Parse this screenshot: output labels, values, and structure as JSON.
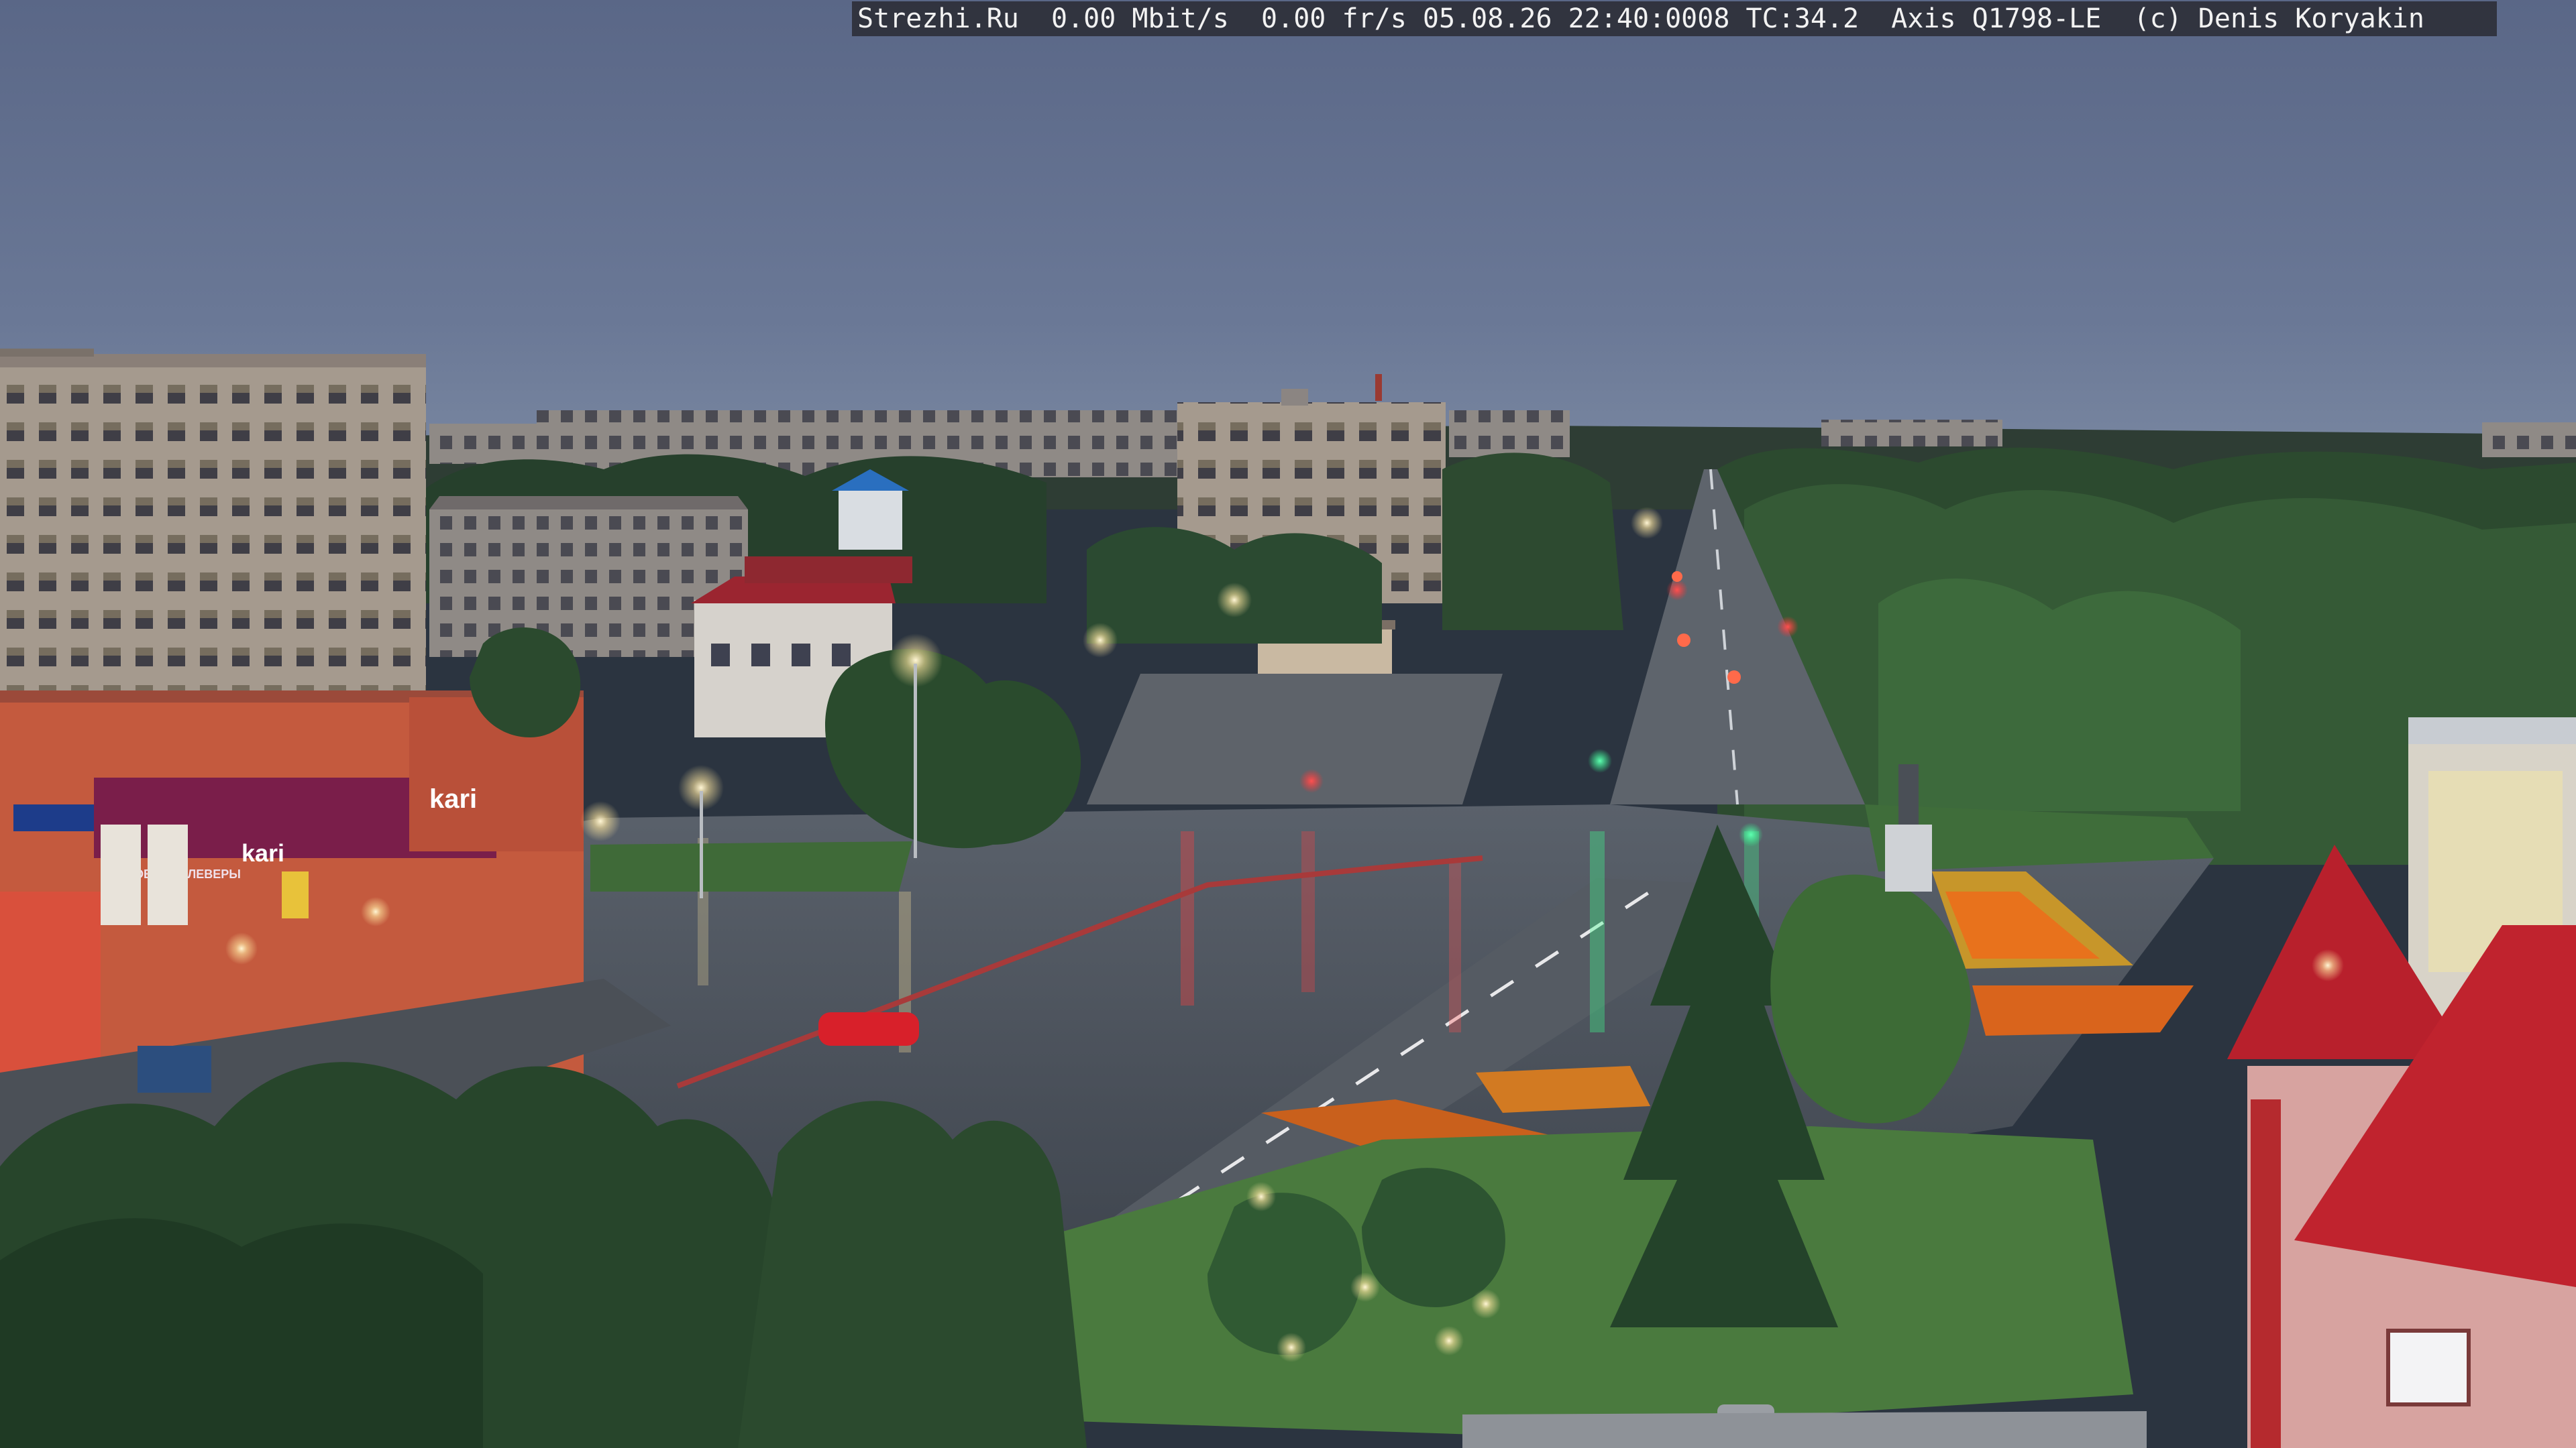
{
  "camera_overlay": {
    "text": "Strezhi.Ru  0.00 Mbit/s  0.00 fr/s 05.08.26 22:40:0008 TC:34.2  Axis Q1798-LE  (c) Denis Koryakin",
    "background": "#2a2a32",
    "color": "#f2f2f2"
  },
  "signs": {
    "store_left": "kari",
    "store_upper": "kari",
    "banner": "ОБУВЬ КЛЕВЕРЫ"
  },
  "scene": {
    "time_of_day": "dusk",
    "weather": "wet after rain",
    "sky_color": "#5d6b85",
    "accent_colors": {
      "street_light": "#fff4c8",
      "traffic_red": "#ff3b3b",
      "traffic_green": "#36ff9a",
      "flowerbed": "#e8721c",
      "roof_red": "#b8202c",
      "car_red": "#d8202a"
    }
  }
}
